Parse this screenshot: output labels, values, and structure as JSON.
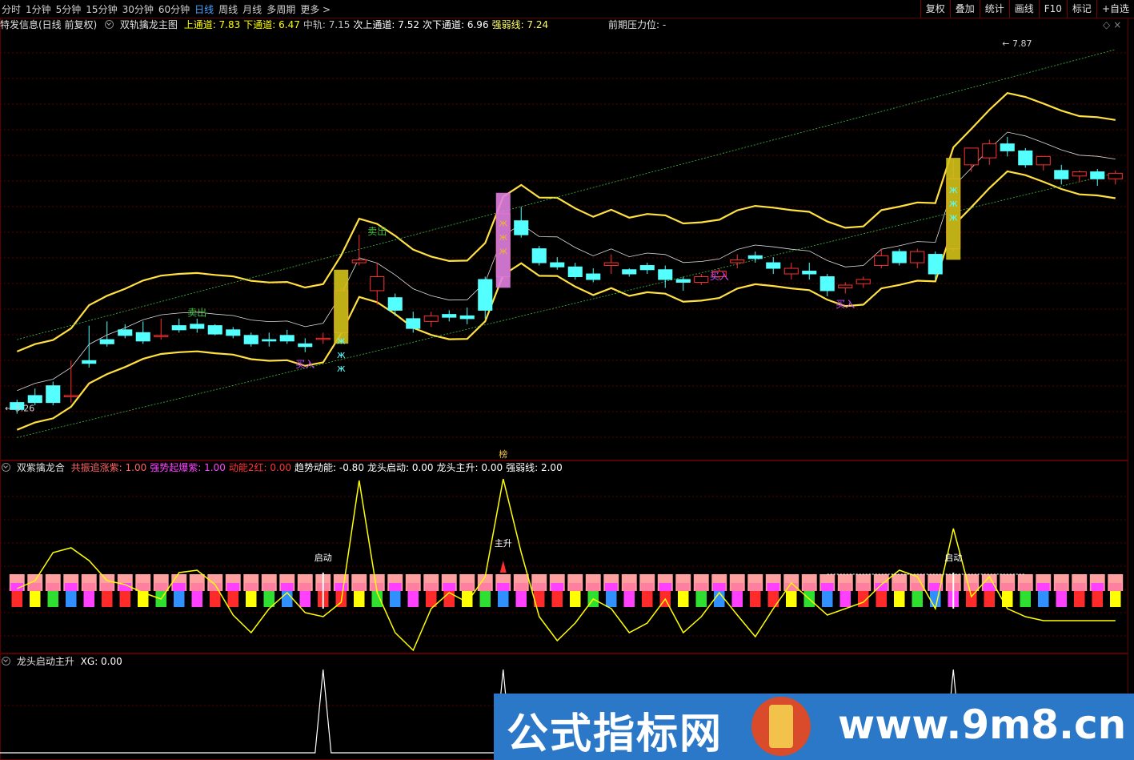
{
  "toolbar": {
    "periods": [
      "分时",
      "1分钟",
      "5分钟",
      "15分钟",
      "30分钟",
      "60分钟",
      "日线",
      "周线",
      "月线",
      "多周期",
      "更多 >"
    ],
    "active": "日线",
    "right": [
      "复权",
      "叠加",
      "统计",
      "画线",
      "F10",
      "标记",
      "+自选"
    ]
  },
  "main": {
    "title": "特发信息(日线 前复权)",
    "indicator": "双轨擒龙主图",
    "items": [
      {
        "label": "上通道: 7.83",
        "color": "#ffff00"
      },
      {
        "label": "下通道: 6.47",
        "color": "#ffff00"
      },
      {
        "label": "中轨: 7.15",
        "color": "#c0c0c0"
      },
      {
        "label": "次上通道: 7.52",
        "color": "#ffffff"
      },
      {
        "label": "次下通道: 6.96",
        "color": "#ffffff"
      },
      {
        "label": "强弱线: 7.24",
        "color": "#ffff66"
      }
    ],
    "pressure": "前期压力位: -",
    "high_label": "7.87",
    "low_label": "5.26",
    "annotations": [
      "卖出",
      "卖出",
      "买入",
      "买入",
      "买入"
    ],
    "bottom_tag": "榜"
  },
  "panel2": {
    "title": "双紫擒龙合",
    "items": [
      {
        "label": "共振追涨紫: 1.00",
        "color": "#ff6666"
      },
      {
        "label": "强势起爆紫: 1.00",
        "color": "#ff44ff"
      },
      {
        "label": "动能2红: 0.00",
        "color": "#ff3333"
      },
      {
        "label": "趋势动能: -0.80",
        "color": "#ffffff"
      },
      {
        "label": "龙头启动: 0.00",
        "color": "#ffffff"
      },
      {
        "label": "龙头主升: 0.00",
        "color": "#ffffff"
      },
      {
        "label": "强弱线: 2.00",
        "color": "#ffffff"
      }
    ],
    "markers": [
      "启动",
      "主升",
      "启动"
    ]
  },
  "panel3": {
    "title": "龙头启动主升",
    "items": [
      {
        "label": "XG: 0.00",
        "color": "#ffffff"
      }
    ]
  },
  "watermark": {
    "text1": "公式指标网",
    "text2": "www.9m8.cn"
  },
  "colors": {
    "up": "#ff3030",
    "down": "#54ffff",
    "channel": "#ffe040",
    "grid": "#5a0000",
    "signal": "#ffff00"
  },
  "chart_data": {
    "type": "candlestick",
    "candles": [
      [
        5.3,
        5.32,
        5.25,
        5.22
      ],
      [
        5.35,
        5.4,
        5.3,
        5.28
      ],
      [
        5.42,
        5.45,
        5.3,
        5.28
      ],
      [
        5.35,
        5.6,
        5.35,
        5.3
      ],
      [
        5.6,
        5.85,
        5.58,
        5.55
      ],
      [
        5.75,
        5.88,
        5.72,
        5.7
      ],
      [
        5.82,
        5.86,
        5.78,
        5.76
      ],
      [
        5.8,
        5.88,
        5.74,
        5.72
      ],
      [
        5.78,
        5.9,
        5.78,
        5.75
      ],
      [
        5.85,
        5.9,
        5.82,
        5.8
      ],
      [
        5.86,
        5.9,
        5.83,
        5.8
      ],
      [
        5.85,
        5.86,
        5.79,
        5.78
      ],
      [
        5.82,
        5.84,
        5.78,
        5.76
      ],
      [
        5.78,
        5.8,
        5.72,
        5.7
      ],
      [
        5.75,
        5.8,
        5.74,
        5.7
      ],
      [
        5.78,
        5.82,
        5.74,
        5.72
      ],
      [
        5.72,
        5.76,
        5.7,
        5.66
      ],
      [
        5.76,
        5.8,
        5.76,
        5.72
      ],
      [
        5.8,
        6.12,
        6.1,
        5.78
      ],
      [
        6.3,
        6.5,
        6.32,
        6.28
      ],
      [
        6.1,
        6.3,
        6.2,
        6.0
      ],
      [
        6.05,
        6.08,
        5.96,
        5.92
      ],
      [
        5.9,
        5.95,
        5.83,
        5.8
      ],
      [
        5.88,
        5.95,
        5.92,
        5.84
      ],
      [
        5.93,
        5.96,
        5.91,
        5.88
      ],
      [
        5.92,
        5.98,
        5.9,
        5.86
      ],
      [
        6.18,
        6.2,
        5.96,
        5.9
      ],
      [
        6.2,
        6.68,
        6.65,
        6.18
      ],
      [
        6.6,
        6.7,
        6.5,
        6.48
      ],
      [
        6.4,
        6.42,
        6.3,
        6.28
      ],
      [
        6.3,
        6.34,
        6.27,
        6.25
      ],
      [
        6.27,
        6.3,
        6.2,
        6.18
      ],
      [
        6.22,
        6.26,
        6.18,
        6.16
      ],
      [
        6.28,
        6.36,
        6.3,
        6.22
      ],
      [
        6.25,
        6.26,
        6.22,
        6.2
      ],
      [
        6.28,
        6.3,
        6.25,
        6.22
      ],
      [
        6.25,
        6.28,
        6.18,
        6.12
      ],
      [
        6.18,
        6.2,
        6.16,
        6.1
      ],
      [
        6.16,
        6.22,
        6.2,
        6.14
      ],
      [
        6.2,
        6.26,
        6.24,
        6.18
      ],
      [
        6.3,
        6.36,
        6.32,
        6.26
      ],
      [
        6.35,
        6.38,
        6.33,
        6.3
      ],
      [
        6.3,
        6.34,
        6.26,
        6.22
      ],
      [
        6.22,
        6.3,
        6.26,
        6.18
      ],
      [
        6.24,
        6.3,
        6.22,
        6.18
      ],
      [
        6.2,
        6.22,
        6.1,
        6.06
      ],
      [
        6.12,
        6.16,
        6.14,
        6.08
      ],
      [
        6.15,
        6.2,
        6.18,
        6.12
      ],
      [
        6.28,
        6.4,
        6.35,
        6.26
      ],
      [
        6.38,
        6.4,
        6.3,
        6.28
      ],
      [
        6.3,
        6.4,
        6.38,
        6.26
      ],
      [
        6.36,
        6.38,
        6.22,
        6.18
      ],
      [
        6.4,
        7.04,
        6.9,
        6.38
      ],
      [
        7.0,
        7.1,
        7.12,
        6.95
      ],
      [
        7.05,
        7.18,
        7.15,
        7.0
      ],
      [
        7.15,
        7.2,
        7.1,
        7.06
      ],
      [
        7.1,
        7.12,
        7.0,
        6.98
      ],
      [
        7.0,
        7.04,
        7.06,
        6.96
      ],
      [
        6.96,
        7.0,
        6.9,
        6.86
      ],
      [
        6.92,
        6.96,
        6.95,
        6.88
      ],
      [
        6.95,
        6.97,
        6.9,
        6.85
      ],
      [
        6.9,
        6.96,
        6.94,
        6.86
      ]
    ]
  }
}
